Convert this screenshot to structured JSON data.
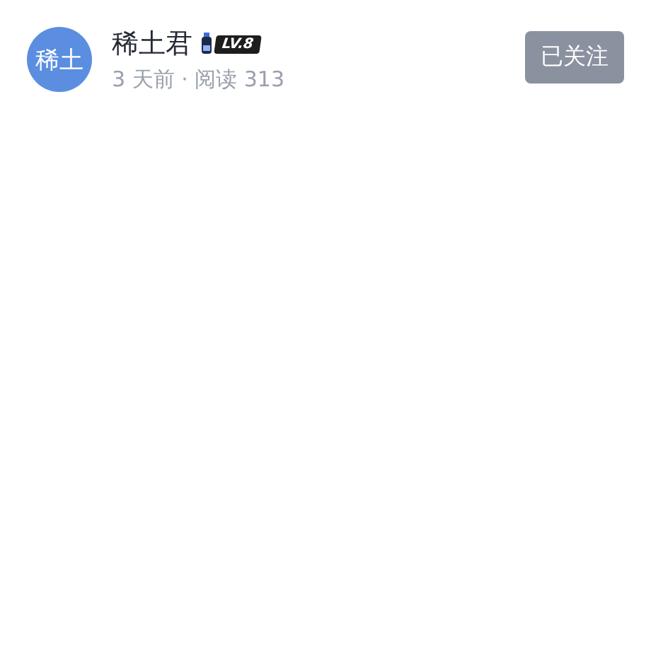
{
  "author": {
    "avatar_text": "稀土",
    "name": "稀土君",
    "level_badge": "LV.8",
    "meta": "3 天前 · 阅读 313"
  },
  "follow_button": {
    "label": "已关注",
    "selected": true
  }
}
